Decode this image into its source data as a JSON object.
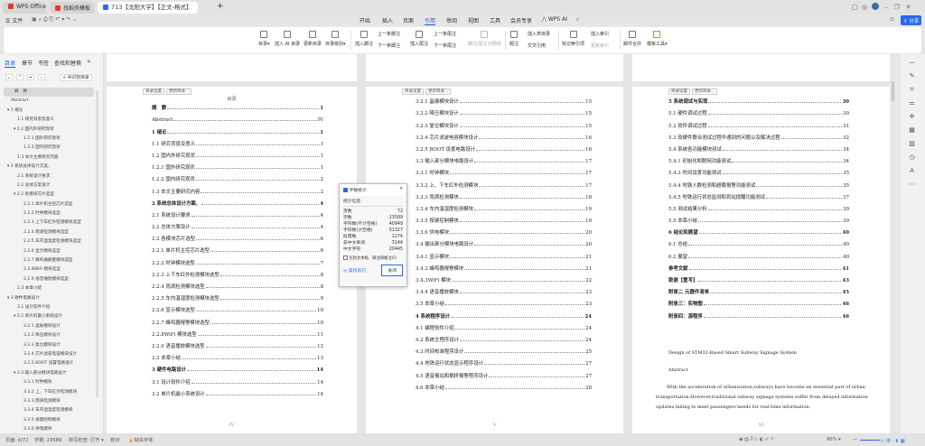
{
  "tabs": [
    {
      "label": "WPS Office",
      "color": "#e23c2c"
    },
    {
      "label": "找稻壳模板",
      "color": "#e23c2c"
    },
    {
      "label": "713【沈阳大学】【正文-格式】",
      "color": "#2a6ae8"
    }
  ],
  "menus": [
    "文件",
    "开始",
    "插入",
    "页面",
    "引用",
    "审阅",
    "视图",
    "工具",
    "会员专享",
    "WPS AI"
  ],
  "active_menu": "引用",
  "share_label": "分享",
  "ribbon": {
    "toc": "目录",
    "ai_toc": "插入 AI 目录",
    "update_toc": "更新目录",
    "toc_level": "目录级别",
    "insert_footnote": "插入脚注",
    "prev_footnote": "上一条脚注",
    "next_footnote": "下一条脚注",
    "insert_endnote": "插入尾注",
    "prev_endnote": "上一条尾注",
    "next_endnote": "下一条尾注",
    "separator": "脚注/尾注分隔线",
    "caption": "题注",
    "insert_table_toc": "插入表目录",
    "cross_ref": "交叉引用",
    "mark_index": "标记索引项",
    "insert_index": "插入索引",
    "update_index": "更新索引",
    "mail_merge": "邮件合并",
    "doc_tools": "模板工具"
  },
  "sidebar": {
    "tabs": [
      "目录",
      "章节",
      "书签",
      "查找和替换"
    ],
    "ai_button": "AI识别目录",
    "items": [
      {
        "label": "摘　要",
        "level": 0,
        "caret": false,
        "selected": true
      },
      {
        "label": "Abstract",
        "level": 0,
        "caret": false
      },
      {
        "label": "1 绪论",
        "level": 0,
        "caret": true
      },
      {
        "label": "1.1 研究背景及意义",
        "level": 1,
        "caret": false
      },
      {
        "label": "1.2 国内外研究现状",
        "level": 1,
        "caret": true
      },
      {
        "label": "1.2.1 国外研究现状",
        "level": 2,
        "caret": false
      },
      {
        "label": "1.2.2 国内研究现状",
        "level": 2,
        "caret": false
      },
      {
        "label": "1.3 本文主要研究内容",
        "level": 1,
        "caret": false
      },
      {
        "label": "2 系统总体设计方案、",
        "level": 0,
        "caret": true
      },
      {
        "label": "2.1 系统设计要求",
        "level": 1,
        "caret": false
      },
      {
        "label": "2.2 总体方案设计",
        "level": 1,
        "caret": false
      },
      {
        "label": "2.2 各模块芯片选型",
        "level": 1,
        "caret": true
      },
      {
        "label": "2.2.1 单片机主控芯片选型",
        "level": 2,
        "caret": false
      },
      {
        "label": "2.2.2 时钟模块选型",
        "level": 2,
        "caret": false
      },
      {
        "label": "2.2.3 上下车红外检测模块选型",
        "level": 2,
        "caret": false
      },
      {
        "label": "2.2.4 雨滴检测模块选型",
        "level": 2,
        "caret": false
      },
      {
        "label": "2.2.5 车内温湿度检测模块选型",
        "level": 2,
        "caret": false
      },
      {
        "label": "2.2.6 显示模块选型",
        "level": 2,
        "caret": false
      },
      {
        "label": "2.2.7 蜂鸣器报警模块选型",
        "level": 2,
        "caret": false
      },
      {
        "label": "2.2.8WiFi 模块选型",
        "level": 2,
        "caret": false
      },
      {
        "label": "2.2.9 语音播放模块选型",
        "level": 2,
        "caret": false
      },
      {
        "label": "2.3 本章小结",
        "level": 1,
        "caret": false
      },
      {
        "label": "3 硬件电路设计",
        "level": 0,
        "caret": true
      },
      {
        "label": "3.1 设计软件介绍",
        "level": 1,
        "caret": false
      },
      {
        "label": "3.2 单片机最小系统设计",
        "level": 1,
        "caret": true
      },
      {
        "label": "3.2.1 晶振模块设计",
        "level": 2,
        "caret": false
      },
      {
        "label": "3.2.2 降压模块设计",
        "level": 2,
        "caret": false
      },
      {
        "label": "3.2.3 复位模块设计",
        "level": 2,
        "caret": false
      },
      {
        "label": "3.2.4 芯片滤波电容模块设计",
        "level": 2,
        "caret": false
      },
      {
        "label": "3.2.5 BOOT 设置电路设计",
        "level": 2,
        "caret": false
      },
      {
        "label": "3.3 输入部分模块电路设计",
        "level": 1,
        "caret": true
      },
      {
        "label": "3.3.1 时钟模块",
        "level": 2,
        "caret": false
      },
      {
        "label": "3.3.2 上、下车红外检测模块",
        "level": 2,
        "caret": false
      },
      {
        "label": "3.3.3 雨滴检测模块",
        "level": 2,
        "caret": false
      },
      {
        "label": "3.3.4 车内温湿度检测模块",
        "level": 2,
        "caret": false
      },
      {
        "label": "3.3.5 按键控制模块",
        "level": 2,
        "caret": false
      },
      {
        "label": "3.3.6 供电模块",
        "level": 2,
        "caret": false
      }
    ]
  },
  "toc_bar": {
    "settings": "目录设置",
    "update": "更新目录..."
  },
  "page1": {
    "heading": "目录",
    "footer": "IV",
    "entries": [
      {
        "t": "摘　要",
        "p": "1",
        "b": true
      },
      {
        "t": "Abstract",
        "p": "IV"
      },
      {
        "t": "1 绪论",
        "p": "1",
        "b": true
      },
      {
        "t": "1.1 研究背景及意义",
        "p": "1"
      },
      {
        "t": "1.2 国内外研究现状",
        "p": "1"
      },
      {
        "t": "1.2.1 国外研究现状",
        "p": "1"
      },
      {
        "t": "1.2.2 国内研究现状",
        "p": "2"
      },
      {
        "t": "1.3 本文主要研究内容",
        "p": "2"
      },
      {
        "t": "2 系统总体设计方案、",
        "p": "4",
        "b": true
      },
      {
        "t": "2.1  系统设计要求",
        "p": "4"
      },
      {
        "t": "2.2 总体方案设计",
        "p": "4"
      },
      {
        "t": "2.2 各模块芯片选型",
        "p": "6"
      },
      {
        "t": "2.2.1 单片机主控芯片选型",
        "p": "6"
      },
      {
        "t": "2.2.2 时钟模块选型",
        "p": "7"
      },
      {
        "t": "2.2.3 上下车红外检测模块选型",
        "p": "8"
      },
      {
        "t": "2.2.4 雨滴检测模块选型",
        "p": "8"
      },
      {
        "t": "2.2.5 车内温湿度检测模块选型",
        "p": "9"
      },
      {
        "t": "2.2.6 显示模块选型",
        "p": "10"
      },
      {
        "t": "2.2.7  蜂鸣器报警模块选型",
        "p": "10"
      },
      {
        "t": "2.2.8WiFi 模块选型",
        "p": "11"
      },
      {
        "t": "2.2.9 语音播放模块选型",
        "p": "12"
      },
      {
        "t": "2.3  本章小结",
        "p": "13"
      },
      {
        "t": "3 硬件电路设计",
        "p": "14",
        "b": true
      },
      {
        "t": "3.1  设计软件介绍",
        "p": "14"
      },
      {
        "t": "3.2  单片机最小系统设计",
        "p": "14"
      }
    ]
  },
  "page2": {
    "footer": "V",
    "entries": [
      {
        "t": "3.2.1  晶振模块设计",
        "p": "15"
      },
      {
        "t": "3.2.2  降压模块设计",
        "p": "15"
      },
      {
        "t": "3.2.3  复位模块设计",
        "p": "15"
      },
      {
        "t": "3.2.4  芯片滤波电容模块设计",
        "p": "16"
      },
      {
        "t": "3.2.5 BOOT 设置电路设计",
        "p": "16"
      },
      {
        "t": "3.3  输入部分模块电路设计",
        "p": "17"
      },
      {
        "t": "3.3.1 时钟模块",
        "p": "17"
      },
      {
        "t": "3.3.2 上、下车红外检测模块",
        "p": "17"
      },
      {
        "t": "3.3.3 雨滴检测模块",
        "p": "18"
      },
      {
        "t": "3.3.4 车内温湿度检测模块",
        "p": "19"
      },
      {
        "t": "3.3.5 按键控制模块",
        "p": "19"
      },
      {
        "t": "3.3.6 供电模块",
        "p": "20"
      },
      {
        "t": "3.4  输出部分模块电路设计",
        "p": "20"
      },
      {
        "t": "3.4.1 显示模块",
        "p": "21"
      },
      {
        "t": "3.4.2 蜂鸣器报警模块",
        "p": "21"
      },
      {
        "t": "3.4.3WiFi 模块",
        "p": "22"
      },
      {
        "t": "3.4.4 语音播放模块",
        "p": "23"
      },
      {
        "t": "3.5  本章小结",
        "p": "23"
      },
      {
        "t": "4  系统程序设计",
        "p": "24",
        "b": true
      },
      {
        "t": "4.1  编程软件介绍",
        "p": "24"
      },
      {
        "t": "4.2  系统主程序设计",
        "p": "24"
      },
      {
        "t": "4.3  时间校准程序设计",
        "p": "25"
      },
      {
        "t": "4.4  地铁运行状态显示程序设计",
        "p": "27"
      },
      {
        "t": "4.5  语音报站和拥挤报警程序设计",
        "p": "27"
      },
      {
        "t": "4.6  本章小结",
        "p": "28"
      }
    ]
  },
  "page3": {
    "footer": "VI",
    "entries": [
      {
        "t": "5  系统调试与实现",
        "p": "30",
        "b": true
      },
      {
        "t": "5.1 硬件调试过程",
        "p": "30"
      },
      {
        "t": "5.2 软件调试过程",
        "p": "31"
      },
      {
        "t": "5.3  软硬件联合测试过程中遇到的问题以及解决过程",
        "p": "32"
      },
      {
        "t": "5.4 系统各功能模块测试",
        "p": "34"
      },
      {
        "t": "5.4.1  初始化和联网功能测试",
        "p": "34"
      },
      {
        "t": "5.4.3  时间设置功能测试",
        "p": "35"
      },
      {
        "t": "5.4.4  地铁人数检测和超载报警功能测试",
        "p": "35"
      },
      {
        "t": "5.4.5  地铁运行状态监测和到站提醒功能测试",
        "p": "37"
      },
      {
        "t": "5.5 测试结果分析",
        "p": "39"
      },
      {
        "t": "5.5  本章小结",
        "p": "39"
      },
      {
        "t": "6 结论和展望",
        "p": "40",
        "b": true
      },
      {
        "t": "6.1  总结",
        "p": "40"
      },
      {
        "t": "6.2  展望",
        "p": "40"
      },
      {
        "t": "参考文献",
        "p": "41",
        "b": true
      },
      {
        "t": "致谢【重写】",
        "p": "43",
        "b": true
      },
      {
        "t": "附录二  元器件清单",
        "p": "45",
        "b": true
      },
      {
        "t": "附录三：实物图",
        "p": "46",
        "b": true
      },
      {
        "t": "附录四：源程序",
        "p": "46",
        "b": true
      }
    ],
    "title": "Design of STM32-Based Smart Subway Signage System",
    "abstract_head": "Abstract",
    "abstract": "With the acceleration of urbanization,subways have become an essential part of urban transportation.However,traditional subway signage systems suffer from delayed information updates,failing to meet passengers'needs for real-time information."
  },
  "dialog": {
    "title": "字数统计",
    "section": "统计信息",
    "rows": [
      {
        "k": "页数",
        "v": "72"
      },
      {
        "k": "字数",
        "v": "23589"
      },
      {
        "k": "字符数(不计空格)",
        "v": "40949"
      },
      {
        "k": "字符数(计空格)",
        "v": "51327"
      },
      {
        "k": "段落数",
        "v": "1274"
      },
      {
        "k": "非中文单词",
        "v": "3144"
      },
      {
        "k": "中文字符",
        "v": "20445"
      }
    ],
    "checkbox": "包括文本框、脚注和尾注(F)",
    "tips": "操作技巧",
    "close": "关闭"
  },
  "status": {
    "page": "页面: 4/72",
    "words": "字数: 23589",
    "spell": "拼写检查: 打开",
    "proof": "校对",
    "font_warning": "缺失字体",
    "zoom": "90%"
  }
}
